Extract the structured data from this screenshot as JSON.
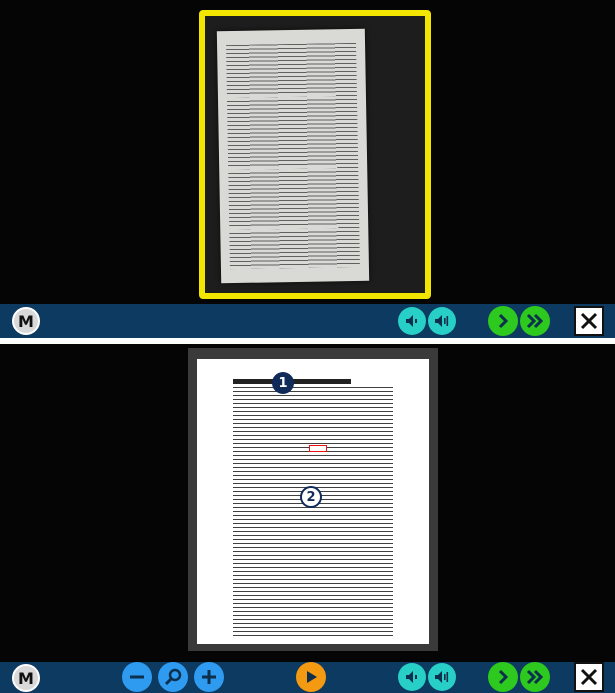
{
  "top_screen": {
    "toolbar": {
      "menu_label": "M",
      "speaker_low_icon": "speaker-low-icon",
      "speaker_high_icon": "speaker-high-icon",
      "next_icon": "chevron-right-icon",
      "fast_forward_icon": "double-chevron-right-icon",
      "close_icon": "close-icon"
    }
  },
  "bottom_screen": {
    "badges": {
      "first": "1",
      "second": "2"
    },
    "toolbar": {
      "menu_label": "M",
      "zoom_out_icon": "minus-icon",
      "zoom_icon": "magnifier-icon",
      "zoom_in_icon": "plus-icon",
      "play_icon": "play-icon",
      "speaker_low_icon": "speaker-low-icon",
      "speaker_high_icon": "speaker-high-icon",
      "next_icon": "chevron-right-icon",
      "fast_forward_icon": "double-chevron-right-icon",
      "close_icon": "close-icon"
    }
  },
  "colors": {
    "toolbar_bg": "#0d3a60",
    "frame_yellow": "#f2e600",
    "teal_button": "#27cfc6",
    "green_button": "#2ec91f",
    "blue_button": "#2e9bf0",
    "orange_button": "#f39a12",
    "badge_navy": "#102a5a",
    "highlight_red": "#e11111"
  }
}
